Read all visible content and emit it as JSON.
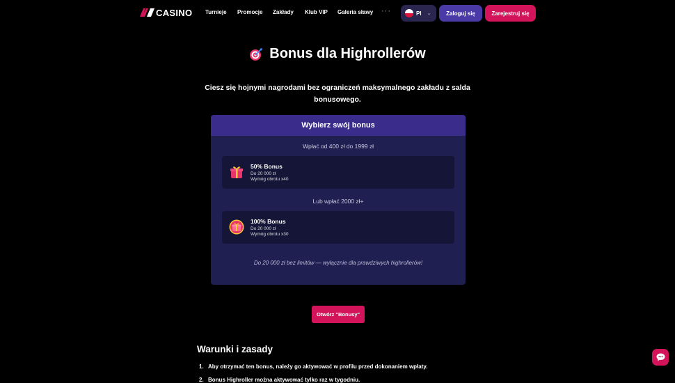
{
  "header": {
    "logo_text": "CASINO",
    "nav": [
      {
        "label": "Turnieje"
      },
      {
        "label": "Promocje"
      },
      {
        "label": "Zakłady"
      },
      {
        "label": "Klub VIP"
      },
      {
        "label": "Galeria sławy"
      }
    ],
    "more_label": "···",
    "language": "Pl",
    "login_label": "Zaloguj się",
    "register_label": "Zarejestruj się"
  },
  "hero": {
    "title": "Bonus dla Highrollerów",
    "subtitle": "Ciesz się hojnymi nagrodami bez ograniczeń maksymalnego zakładu z salda bonusowego."
  },
  "card": {
    "heading": "Wybierz swój bonus",
    "tiers": [
      {
        "deposit_label": "Wpłać od 400 zł do 1999 zł",
        "bonus_name": "50% Bonus",
        "max_amount": "Do 20 000 zł",
        "wagering": "Wymóg obrotu x40"
      },
      {
        "deposit_label": "Lub wpłać 2000 zł+",
        "bonus_name": "100% Bonus",
        "max_amount": "Do 20 000 zł",
        "wagering": "Wymóg obrotu x30"
      }
    ],
    "note": "Do 20 000 zł bez limitów — wyłącznie dla prawdziwych highrollerów!"
  },
  "cta_label": "Otwórz \"Bonusy\"",
  "terms": {
    "title": "Warunki i zasady",
    "items": [
      {
        "num": "1.",
        "text": "Aby otrzymać ten bonus, należy go aktywować w profilu przed dokonaniem wpłaty."
      },
      {
        "num": "2.",
        "text": "Bonus Highroller można aktywować tylko raz w tygodniu."
      }
    ]
  },
  "colors": {
    "background": "#000000",
    "accent_pink": "#d4145a",
    "accent_purple": "#4a3aa8",
    "card_bg": "#1f1f52",
    "card_header": "#3a2c8a",
    "bonus_box": "#151537"
  },
  "icons": {
    "title_icon": "target-dart-icon",
    "bonus_icon": "gift-box-icon",
    "chat_icon": "chat-bubble-icon",
    "flag_icon": "poland-flag-icon"
  }
}
